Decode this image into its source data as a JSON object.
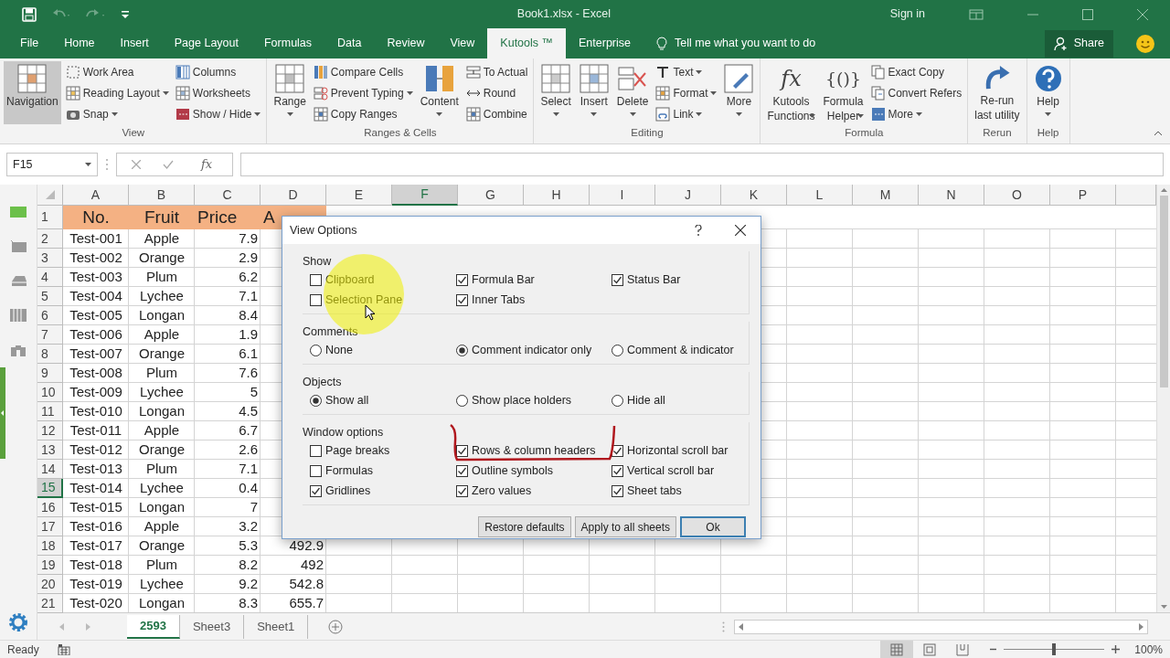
{
  "window": {
    "title": "Book1.xlsx  -  Excel",
    "sign_in": "Sign in"
  },
  "tabs": [
    {
      "label": "File",
      "selected": false
    },
    {
      "label": "Home",
      "selected": false
    },
    {
      "label": "Insert",
      "selected": false
    },
    {
      "label": "Page Layout",
      "selected": false
    },
    {
      "label": "Formulas",
      "selected": false
    },
    {
      "label": "Data",
      "selected": false
    },
    {
      "label": "Review",
      "selected": false
    },
    {
      "label": "View",
      "selected": false
    },
    {
      "label": "Kutools ™",
      "selected": true
    },
    {
      "label": "Enterprise",
      "selected": false
    }
  ],
  "tell_me": "Tell me what you want to do",
  "share": "Share",
  "ribbon": [
    {
      "label": "View",
      "items": [
        {
          "kind": "large",
          "lines": [
            "Navigation"
          ],
          "dropdown": false,
          "pressed": true
        },
        {
          "kind": "small",
          "lines": [
            "Work Area"
          ],
          "dropdown": false,
          "pressed": false
        },
        {
          "kind": "small",
          "lines": [
            "Reading Layout"
          ],
          "dropdown": true,
          "pressed": false
        },
        {
          "kind": "small",
          "lines": [
            "Snap"
          ],
          "dropdown": true,
          "pressed": false
        },
        {
          "kind": "small",
          "lines": [
            "Columns"
          ],
          "dropdown": false,
          "pressed": false
        },
        {
          "kind": "small",
          "lines": [
            "Worksheets"
          ],
          "dropdown": false,
          "pressed": false
        },
        {
          "kind": "small",
          "lines": [
            "Show / Hide"
          ],
          "dropdown": true,
          "pressed": false
        }
      ]
    },
    {
      "label": "Ranges & Cells",
      "items": [
        {
          "kind": "large",
          "lines": [
            "Range"
          ],
          "dropdown": true,
          "pressed": false
        },
        {
          "kind": "small",
          "lines": [
            "Compare Cells"
          ],
          "dropdown": false,
          "pressed": false
        },
        {
          "kind": "small",
          "lines": [
            "Prevent Typing"
          ],
          "dropdown": true,
          "pressed": false
        },
        {
          "kind": "small",
          "lines": [
            "Copy Ranges"
          ],
          "dropdown": false,
          "pressed": false
        },
        {
          "kind": "large",
          "lines": [
            "Content"
          ],
          "dropdown": true,
          "pressed": false
        },
        {
          "kind": "small",
          "lines": [
            "To Actual"
          ],
          "dropdown": false,
          "pressed": false
        },
        {
          "kind": "small",
          "lines": [
            "Round"
          ],
          "dropdown": false,
          "pressed": false
        },
        {
          "kind": "small",
          "lines": [
            "Combine"
          ],
          "dropdown": false,
          "pressed": false
        }
      ]
    },
    {
      "label": "Editing",
      "items": [
        {
          "kind": "large",
          "lines": [
            "Select"
          ],
          "dropdown": true,
          "pressed": false
        },
        {
          "kind": "large",
          "lines": [
            "Insert"
          ],
          "dropdown": true,
          "pressed": false
        },
        {
          "kind": "large",
          "lines": [
            "Delete"
          ],
          "dropdown": true,
          "pressed": false
        },
        {
          "kind": "small",
          "lines": [
            "Text"
          ],
          "dropdown": true,
          "pressed": false
        },
        {
          "kind": "small",
          "lines": [
            "Format"
          ],
          "dropdown": true,
          "pressed": false
        },
        {
          "kind": "small",
          "lines": [
            "Link"
          ],
          "dropdown": true,
          "pressed": false
        },
        {
          "kind": "large",
          "lines": [
            "More"
          ],
          "dropdown": true,
          "pressed": false
        }
      ]
    },
    {
      "label": "Formula",
      "items": [
        {
          "kind": "large",
          "glyph": "fx",
          "lines": [
            "Kutools",
            "Functions"
          ],
          "dropdown": true,
          "pressed": false
        },
        {
          "kind": "large",
          "glyph": "{()}",
          "lines": [
            "Formula",
            "Helper"
          ],
          "dropdown": true,
          "pressed": false
        },
        {
          "kind": "small",
          "lines": [
            "Exact Copy"
          ],
          "dropdown": false,
          "pressed": false
        },
        {
          "kind": "small",
          "lines": [
            "Convert Refers"
          ],
          "dropdown": false,
          "pressed": false
        },
        {
          "kind": "small",
          "lines": [
            "More"
          ],
          "dropdown": true,
          "pressed": false
        }
      ]
    },
    {
      "label": "Rerun",
      "items": [
        {
          "kind": "large",
          "lines": [
            "Re-run",
            "last utility"
          ],
          "dropdown": false,
          "pressed": false
        }
      ]
    },
    {
      "label": "Help",
      "items": [
        {
          "kind": "large",
          "lines": [
            "Help"
          ],
          "dropdown": true,
          "pressed": false
        }
      ]
    }
  ],
  "formula_bar": {
    "name_box": "F15",
    "function_label": "fx"
  },
  "sheet": {
    "columns": [
      {
        "label": "A",
        "selected": false
      },
      {
        "label": "B",
        "selected": false
      },
      {
        "label": "C",
        "selected": false
      },
      {
        "label": "D",
        "selected": false
      },
      {
        "label": "E",
        "selected": false
      },
      {
        "label": "F",
        "selected": true
      },
      {
        "label": "G",
        "selected": false
      },
      {
        "label": "H",
        "selected": false
      },
      {
        "label": "I",
        "selected": false
      },
      {
        "label": "J",
        "selected": false
      },
      {
        "label": "K",
        "selected": false
      },
      {
        "label": "L",
        "selected": false
      },
      {
        "label": "M",
        "selected": false
      },
      {
        "label": "N",
        "selected": false
      },
      {
        "label": "O",
        "selected": false
      },
      {
        "label": "P",
        "selected": false
      }
    ],
    "rows": [
      {
        "label": "1",
        "kind": "heading",
        "selected": false,
        "cells": [
          "No.",
          "Fruit",
          "Price",
          "A"
        ]
      },
      {
        "label": "2",
        "kind": "data",
        "selected": false,
        "cells": [
          "Test-001",
          "Apple",
          "7.9"
        ]
      },
      {
        "label": "3",
        "kind": "data",
        "selected": false,
        "cells": [
          "Test-002",
          "Orange",
          "2.9"
        ]
      },
      {
        "label": "4",
        "kind": "data",
        "selected": false,
        "cells": [
          "Test-003",
          "Plum",
          "6.2"
        ]
      },
      {
        "label": "5",
        "kind": "data",
        "selected": false,
        "cells": [
          "Test-004",
          "Lychee",
          "7.1"
        ]
      },
      {
        "label": "6",
        "kind": "data",
        "selected": false,
        "cells": [
          "Test-005",
          "Longan",
          "8.4"
        ]
      },
      {
        "label": "7",
        "kind": "data",
        "selected": false,
        "cells": [
          "Test-006",
          "Apple",
          "1.9"
        ]
      },
      {
        "label": "8",
        "kind": "data",
        "selected": false,
        "cells": [
          "Test-007",
          "Orange",
          "6.1"
        ]
      },
      {
        "label": "9",
        "kind": "data",
        "selected": false,
        "cells": [
          "Test-008",
          "Plum",
          "7.6"
        ]
      },
      {
        "label": "10",
        "kind": "data",
        "selected": false,
        "cells": [
          "Test-009",
          "Lychee",
          "5"
        ]
      },
      {
        "label": "11",
        "kind": "data",
        "selected": false,
        "cells": [
          "Test-010",
          "Longan",
          "4.5"
        ]
      },
      {
        "label": "12",
        "kind": "data",
        "selected": false,
        "cells": [
          "Test-011",
          "Apple",
          "6.7"
        ]
      },
      {
        "label": "13",
        "kind": "data",
        "selected": false,
        "cells": [
          "Test-012",
          "Orange",
          "2.6"
        ]
      },
      {
        "label": "14",
        "kind": "data",
        "selected": false,
        "cells": [
          "Test-013",
          "Plum",
          "7.1"
        ]
      },
      {
        "label": "15",
        "kind": "data",
        "selected": true,
        "cells": [
          "Test-014",
          "Lychee",
          "0.4"
        ]
      },
      {
        "label": "16",
        "kind": "data",
        "selected": false,
        "cells": [
          "Test-015",
          "Longan",
          "7"
        ]
      },
      {
        "label": "17",
        "kind": "data",
        "selected": false,
        "cells": [
          "Test-016",
          "Apple",
          "3.2"
        ]
      },
      {
        "label": "18",
        "kind": "data",
        "selected": false,
        "cells": [
          "Test-017",
          "Orange",
          "5.3",
          "492.9"
        ]
      },
      {
        "label": "19",
        "kind": "data",
        "selected": false,
        "cells": [
          "Test-018",
          "Plum",
          "8.2",
          "492"
        ]
      },
      {
        "label": "20",
        "kind": "data",
        "selected": false,
        "cells": [
          "Test-019",
          "Lychee",
          "9.2",
          "542.8"
        ]
      },
      {
        "label": "21",
        "kind": "data",
        "selected": false,
        "cells": [
          "Test-020",
          "Longan",
          "8.3",
          "655.7"
        ]
      }
    ]
  },
  "sheet_tabs": [
    {
      "label": "2593",
      "selected": true
    },
    {
      "label": "Sheet3",
      "selected": false
    },
    {
      "label": "Sheet1",
      "selected": false
    }
  ],
  "dialog": {
    "title": "View Options",
    "sections": [
      {
        "title": "Show",
        "kind": "checkbox",
        "columns": [
          [
            {
              "label": "Clipboard",
              "checked": false
            },
            {
              "label": "Selection Pane",
              "checked": false
            }
          ],
          [
            {
              "label": "Formula Bar",
              "checked": true
            },
            {
              "label": "Inner Tabs",
              "checked": true
            }
          ],
          [
            {
              "label": "Status Bar",
              "checked": true
            }
          ]
        ]
      },
      {
        "title": "Comments",
        "kind": "radio",
        "columns": [
          [
            {
              "label": "None",
              "selected": false
            }
          ],
          [
            {
              "label": "Comment indicator only",
              "selected": true
            }
          ],
          [
            {
              "label": "Comment & indicator",
              "selected": false
            }
          ]
        ]
      },
      {
        "title": "Objects",
        "kind": "radio",
        "columns": [
          [
            {
              "label": "Show all",
              "selected": true
            }
          ],
          [
            {
              "label": "Show place holders",
              "selected": false
            }
          ],
          [
            {
              "label": "Hide all",
              "selected": false
            }
          ]
        ]
      },
      {
        "title": "Window options",
        "kind": "checkbox",
        "columns": [
          [
            {
              "label": "Page breaks",
              "checked": false
            },
            {
              "label": "Formulas",
              "checked": false
            },
            {
              "label": "Gridlines",
              "checked": true
            }
          ],
          [
            {
              "label": "Rows & column headers",
              "checked": true
            },
            {
              "label": "Outline symbols",
              "checked": true
            },
            {
              "label": "Zero values",
              "checked": true
            }
          ],
          [
            {
              "label": "Horizontal scroll bar",
              "checked": true
            },
            {
              "label": "Vertical scroll bar",
              "checked": true
            },
            {
              "label": "Sheet tabs",
              "checked": true
            }
          ]
        ]
      }
    ],
    "buttons": [
      {
        "label": "Restore defaults",
        "default": false
      },
      {
        "label": "Apply to all sheets",
        "default": false
      },
      {
        "label": "Ok",
        "default": true
      }
    ]
  },
  "status_bar": {
    "status": "Ready",
    "views": [
      {
        "kind": "normal",
        "selected": true
      },
      {
        "kind": "page_layout",
        "selected": false
      },
      {
        "kind": "page_break",
        "selected": false
      }
    ],
    "zoom": {
      "level": 0.5,
      "reading": "100%"
    }
  }
}
